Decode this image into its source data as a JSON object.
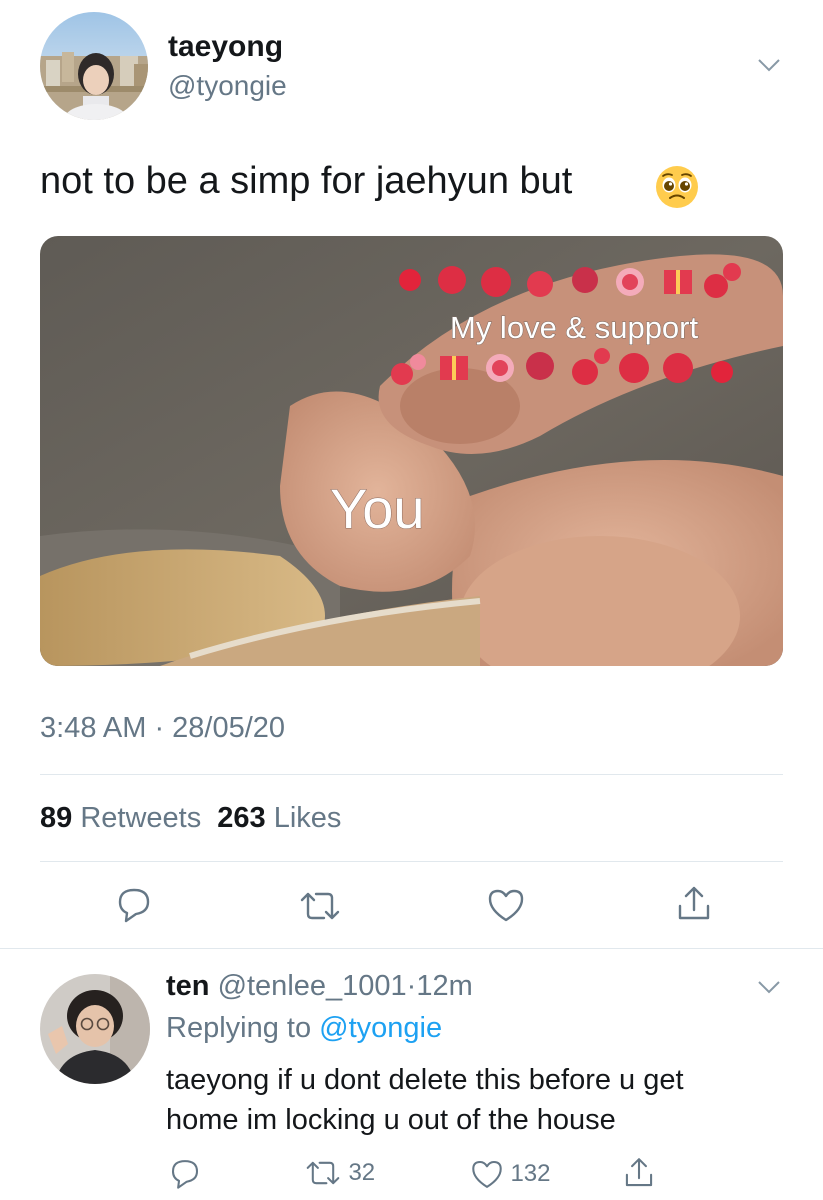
{
  "tweet": {
    "display_name": "taeyong",
    "handle": "@tyongie",
    "text": "not to be a simp for jaehyun but",
    "text_emoji": "pleading-face",
    "timestamp": "3:48 AM · 28/05/20",
    "retweets_count": "89",
    "retweets_label": "Retweets",
    "likes_count": "263",
    "likes_label": "Likes",
    "meme": {
      "caption_top": "My love & support",
      "caption_bottom": "You"
    }
  },
  "reply": {
    "display_name": "ten",
    "handle": "@tenlee_1001",
    "separator": "·",
    "time": "12m",
    "replying_prefix": "Replying to",
    "replying_handle": "@tyongie",
    "text_line1": "taeyong if u dont delete this before u get",
    "text_line2": "home im locking u out of the house",
    "retweets_count": "32",
    "likes_count": "132"
  },
  "colors": {
    "link": "#1da1f2",
    "muted": "#657786",
    "divider": "#e1e8ed",
    "heart": "#e0245e"
  },
  "icons": [
    "chevron-down-icon",
    "reply-icon",
    "retweet-icon",
    "like-icon",
    "share-icon"
  ]
}
